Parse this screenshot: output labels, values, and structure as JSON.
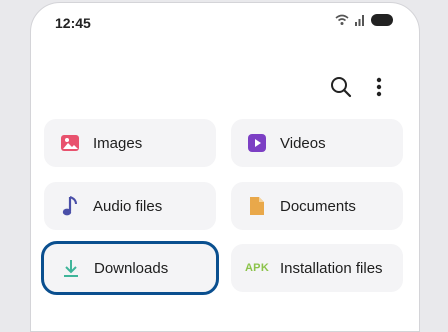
{
  "status": {
    "time": "12:45"
  },
  "toolbar": {
    "search_icon": "search-icon",
    "more_icon": "more-vertical-icon"
  },
  "categories": [
    {
      "label": "Images",
      "icon": "image-icon",
      "color": "#e8526e"
    },
    {
      "label": "Videos",
      "icon": "video-icon",
      "color": "#7c3fc4"
    },
    {
      "label": "Audio files",
      "icon": "music-note-icon",
      "color": "#4a4fa8"
    },
    {
      "label": "Documents",
      "icon": "document-icon",
      "color": "#e9a84a"
    },
    {
      "label": "Downloads",
      "icon": "download-icon",
      "color": "#3fb59a",
      "selected": true
    },
    {
      "label": "Installation files",
      "icon": "apk-icon",
      "icon_text": "APK",
      "color": "#8bc34a"
    }
  ],
  "colors": {
    "selection_outline": "#0a4f8f",
    "card_bg": "#f4f4f6"
  }
}
